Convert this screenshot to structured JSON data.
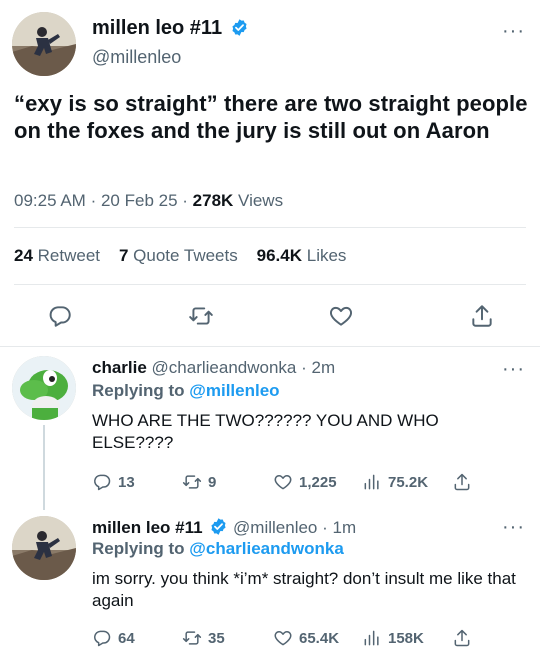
{
  "main_tweet": {
    "author_name": "millen leo #11",
    "handle": "@millenleo",
    "more_glyph": "···",
    "text": "“exy is so straight” there are two straight people on the foxes and the jury is still out on Aaron",
    "time": "09:25 AM",
    "date": "20 Feb 25",
    "separator": "·",
    "views_count": "278K",
    "views_label": "Views",
    "retweets_count": "24",
    "retweets_label": "Retweet",
    "quotes_count": "7",
    "quotes_label": "Quote Tweets",
    "likes_count": "96.4K",
    "likes_label": "Likes",
    "actions": [
      "reply-icon",
      "retweet-icon",
      "like-icon",
      "share-icon"
    ]
  },
  "replies": [
    {
      "author_name": "charlie",
      "handle": "@charlieandwonka",
      "age": "2m",
      "replying_prefix": "Replying to",
      "replying_to": "@millenleo",
      "text": "WHO ARE THE TWO?????? YOU AND WHO ELSE????",
      "reply_count": "13",
      "retweet_count": "9",
      "like_count": "1,225",
      "view_count": "75.2K"
    },
    {
      "author_name": "millen leo #11",
      "handle": "@millenleo",
      "age": "1m",
      "replying_prefix": "Replying to",
      "replying_to": "@charlieandwonka",
      "text": "im sorry. you think *i’m* straight? don’t insult me like that again",
      "reply_count": "64",
      "retweet_count": "35",
      "like_count": "65.4K",
      "view_count": "158K"
    }
  ],
  "colors": {
    "accent": "#1d9bf0",
    "text": "#0f1419",
    "secondary": "#536471",
    "divider": "#e6e9eb"
  }
}
